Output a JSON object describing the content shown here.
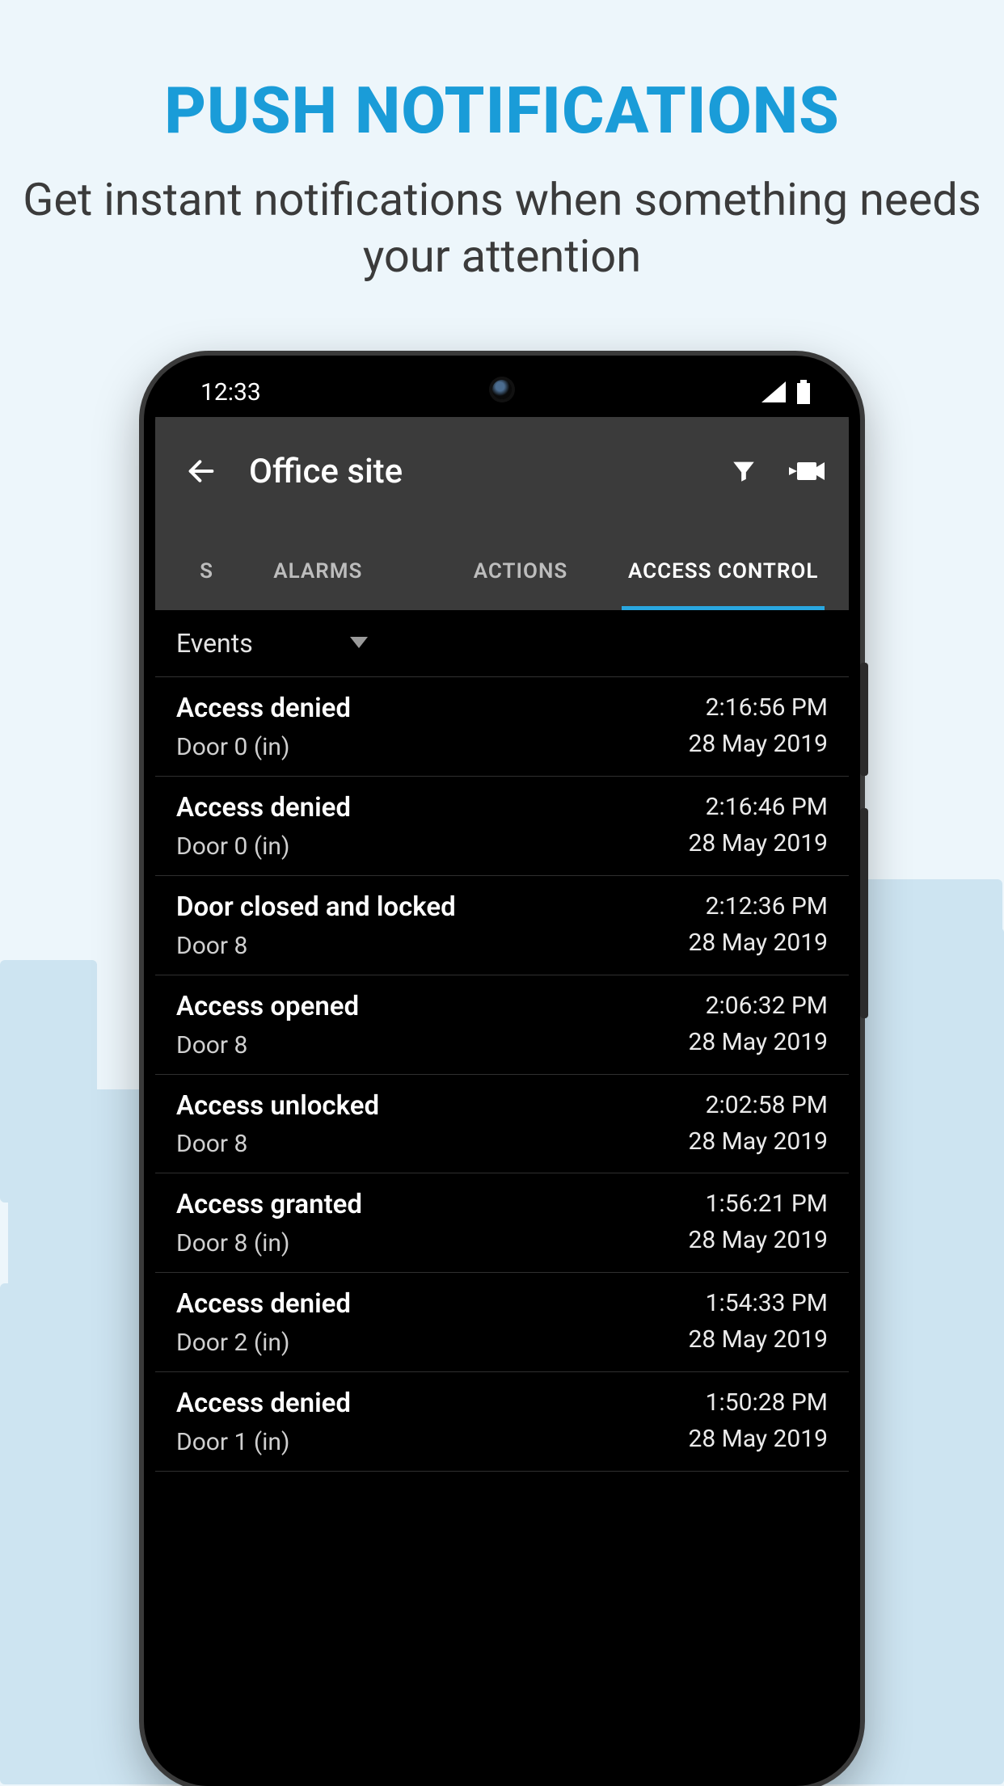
{
  "promo": {
    "title": "PUSH NOTIFICATIONS",
    "subtitle": "Get  instant notifications when something needs your attention"
  },
  "statusbar": {
    "time": "12:33"
  },
  "appbar": {
    "title": "Office site"
  },
  "tabs": {
    "partial": "S",
    "alarms": "ALARMS",
    "actions": "ACTIONS",
    "access_control": "ACCESS CONTROL"
  },
  "filter": {
    "label": "Events"
  },
  "events": [
    {
      "title": "Access denied",
      "subtitle": "Door 0 (in)",
      "time": "2:16:56 PM",
      "date": "28 May 2019"
    },
    {
      "title": "Access denied",
      "subtitle": "Door 0 (in)",
      "time": "2:16:46 PM",
      "date": "28 May 2019"
    },
    {
      "title": "Door closed and locked",
      "subtitle": "Door 8",
      "time": "2:12:36 PM",
      "date": "28 May 2019"
    },
    {
      "title": "Access opened",
      "subtitle": "Door 8",
      "time": "2:06:32 PM",
      "date": "28 May 2019"
    },
    {
      "title": "Access unlocked",
      "subtitle": "Door 8",
      "time": "2:02:58 PM",
      "date": "28 May 2019"
    },
    {
      "title": "Access granted",
      "subtitle": "Door 8 (in)",
      "time": "1:56:21 PM",
      "date": "28 May 2019"
    },
    {
      "title": "Access denied",
      "subtitle": "Door 2 (in)",
      "time": "1:54:33 PM",
      "date": "28 May 2019"
    },
    {
      "title": "Access denied",
      "subtitle": "Door 1 (in)",
      "time": "1:50:28 PM",
      "date": "28 May 2019"
    }
  ]
}
